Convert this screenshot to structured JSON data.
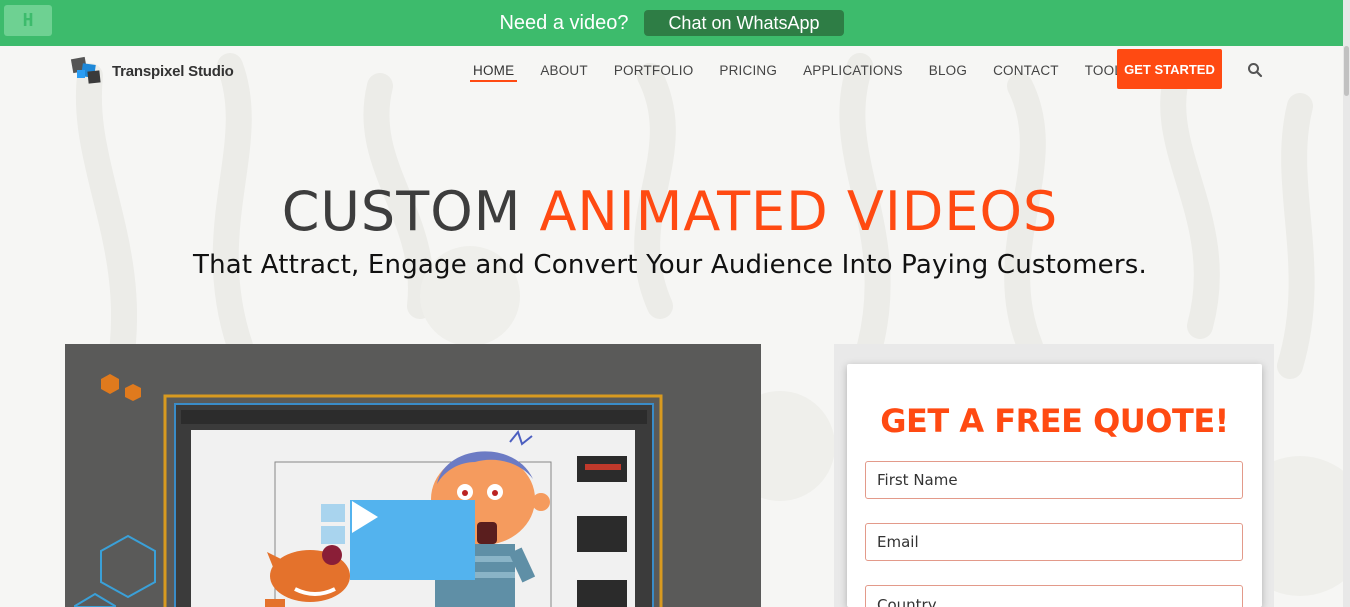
{
  "topbar": {
    "logo_glyph": "H",
    "text": "Need a video?",
    "button_label": "Chat on WhatsApp"
  },
  "header": {
    "brand": "Transpixel Studio",
    "nav": [
      "HOME",
      "ABOUT",
      "PORTFOLIO",
      "PRICING",
      "APPLICATIONS",
      "BLOG",
      "CONTACT",
      "TOOLS"
    ],
    "active_nav": "HOME",
    "cta_label": "GET STARTED",
    "search_icon": "search-icon"
  },
  "hero": {
    "title_dark": "CUSTOM",
    "title_accent": "ANIMATED VIDEOS",
    "subtitle": "That Attract, Engage and Convert Your Audience Into Paying Customers."
  },
  "video": {
    "play_icon": "play-icon"
  },
  "quote": {
    "title": "GET A FREE QUOTE!",
    "fields": {
      "first_name": "First Name",
      "email": "Email",
      "country": "Country"
    }
  },
  "colors": {
    "accent": "#ff4a12",
    "whatsapp_bar": "#3dbb6c",
    "whatsapp_button": "#2e7d45",
    "play": "#53b3ee"
  }
}
